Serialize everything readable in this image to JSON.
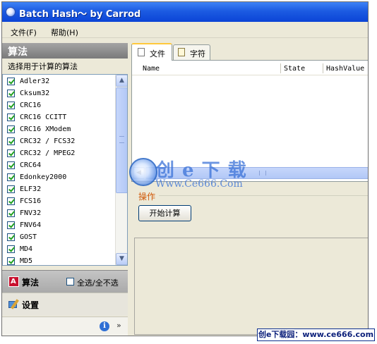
{
  "window": {
    "title": "Batch Hash〜 by Carrod"
  },
  "menu": [
    {
      "label": "文件(F)"
    },
    {
      "label": "帮助(H)"
    }
  ],
  "left_panel": {
    "header": "算法",
    "subtitle": "选择用于计算的算法",
    "algorithms": [
      {
        "label": "Adler32",
        "checked": true
      },
      {
        "label": "Cksum32",
        "checked": true
      },
      {
        "label": "CRC16",
        "checked": true
      },
      {
        "label": "CRC16 CCITT",
        "checked": true
      },
      {
        "label": "CRC16 XModem",
        "checked": true
      },
      {
        "label": "CRC32 / FCS32",
        "checked": true
      },
      {
        "label": "CRC32 / MPEG2",
        "checked": true
      },
      {
        "label": "CRC64",
        "checked": true
      },
      {
        "label": "Edonkey2000",
        "checked": true
      },
      {
        "label": "ELF32",
        "checked": true
      },
      {
        "label": "FCS16",
        "checked": true
      },
      {
        "label": "FNV32",
        "checked": true
      },
      {
        "label": "FNV64",
        "checked": true
      },
      {
        "label": "GOST",
        "checked": true
      },
      {
        "label": "MD4",
        "checked": true
      },
      {
        "label": "MD5",
        "checked": true
      }
    ],
    "sections": {
      "algo_label": "算法",
      "select_all_label": "全选/全不选",
      "settings_label": "设置"
    }
  },
  "tabs": [
    {
      "label": "文件"
    },
    {
      "label": "字符"
    }
  ],
  "results_table": {
    "columns": [
      "Name",
      "State",
      "HashValue"
    ]
  },
  "operations": {
    "group_label": "操作",
    "start_button": "开始计算"
  },
  "watermark": {
    "title": "创 e 下 载",
    "url": "Www.Ce666.Com",
    "footer": "创e下载园：www.ce666.com"
  },
  "colors": {
    "titlebar": "#0b44d6",
    "accent_orange": "#d05a0a",
    "tab_highlight": "#ffc83c"
  }
}
